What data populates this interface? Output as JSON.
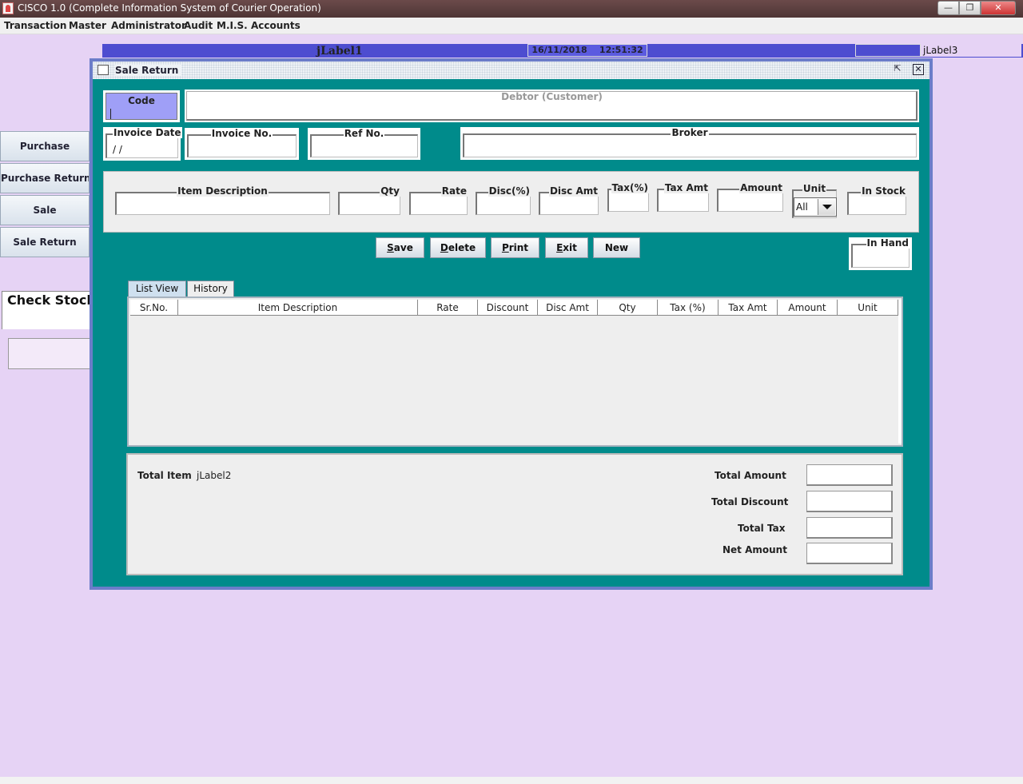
{
  "window": {
    "title": "CISCO 1.0 (Complete Information System of Courier Operation)",
    "min": "—",
    "max": "❐",
    "close": "✕"
  },
  "menu": [
    "Transaction",
    "Master",
    "Administrator",
    "Audit",
    "M.I.S.",
    "Accounts"
  ],
  "status": {
    "label1": "jLabel1",
    "date": "16/11/2018",
    "time": "12:51:32",
    "label3": "jLabel3"
  },
  "sidebar": {
    "items": [
      "Purchase",
      "Purchase Return",
      "Sale",
      "Sale Return"
    ],
    "check_stock": "Check Stock"
  },
  "frame": {
    "title": "Sale Return",
    "code_label": "Code",
    "debtor_label": "Debtor (Customer)",
    "invoice_date_label": "Invoice Date",
    "invoice_date_value": "/ /",
    "invoice_no_label": "Invoice No.",
    "ref_no_label": "Ref No.",
    "broker_label": "Broker",
    "item_fields": {
      "item_description": "Item Description",
      "qty": "Qty",
      "rate": "Rate",
      "disc_pct": "Disc(%)",
      "disc_amt": "Disc Amt",
      "tax_pct": "Tax(%)",
      "tax_amt": "Tax Amt",
      "amount": "Amount",
      "unit": "Unit",
      "unit_value": "All",
      "in_stock": "In Stock",
      "in_hand": "In Hand"
    },
    "buttons": {
      "save": "S",
      "save_rest": "ave",
      "delete": "D",
      "delete_rest": "elete",
      "print": "P",
      "print_rest": "rint",
      "exit": "E",
      "exit_rest": "xit",
      "new": "New"
    },
    "tabs": [
      "List View",
      "History"
    ],
    "table_columns": [
      "Sr.No.",
      "Item Description",
      "Rate",
      "Discount",
      "Disc Amt",
      "Qty",
      "Tax (%)",
      "Tax Amt",
      "Amount",
      "Unit"
    ],
    "totals": {
      "total_item_label": "Total Item",
      "total_item_value": "jLabel2",
      "total_amount_label": "Total Amount",
      "total_discount_label": "Total Discount",
      "total_tax_label": "Total Tax",
      "net_amount_label": "Net Amount"
    }
  }
}
